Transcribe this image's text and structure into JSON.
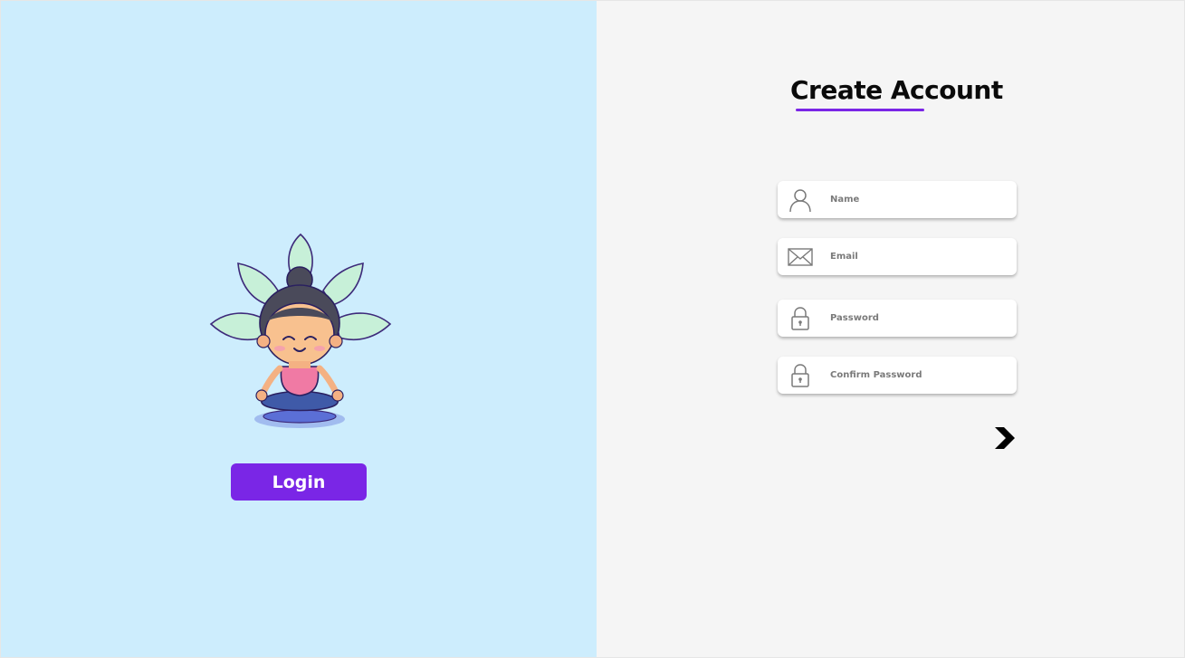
{
  "left_panel": {
    "login_button_label": "Login"
  },
  "form": {
    "title": "Create Account",
    "fields": [
      {
        "placeholder": "Name",
        "icon": "user-icon",
        "value": ""
      },
      {
        "placeholder": "Email",
        "icon": "mail-icon",
        "value": ""
      },
      {
        "placeholder": "Password",
        "icon": "lock-icon",
        "value": ""
      },
      {
        "placeholder": "Confirm Password",
        "icon": "lock-icon",
        "value": ""
      }
    ],
    "next_icon": "chevron-right-icon"
  },
  "colors": {
    "left_background": "#cdedfd",
    "right_background": "#f5f5f5",
    "accent": "#7a26e6",
    "icon_gray": "#7a7a7a"
  }
}
